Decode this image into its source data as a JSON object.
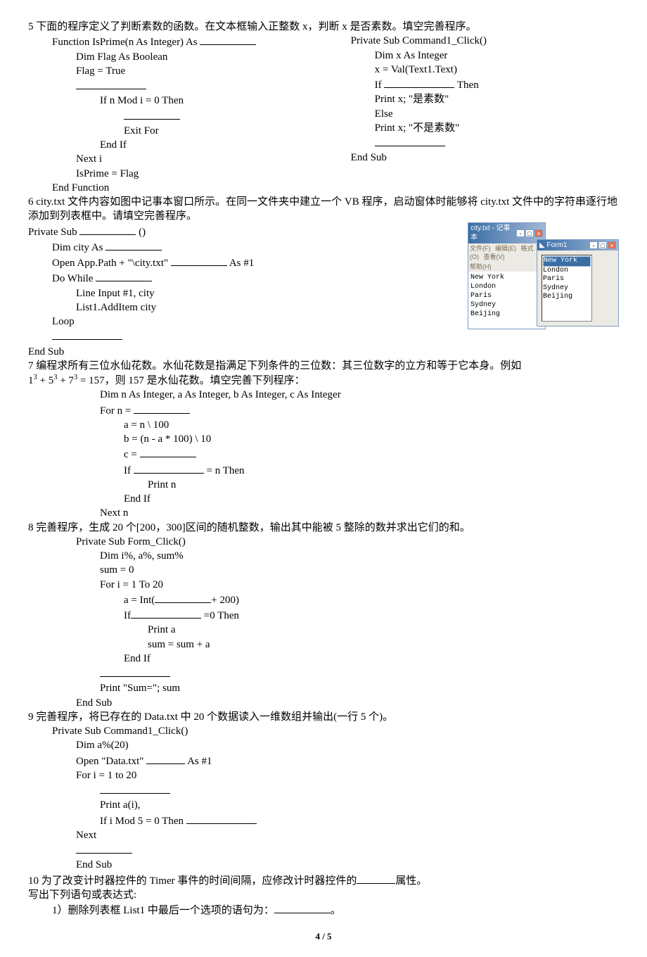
{
  "q5": {
    "prompt": "5 下面的程序定义了判断素数的函数。在文本框输入正整数 x，判断 x 是否素数。填空完善程序。",
    "left": {
      "l1a": "Function IsPrime(n As Integer) As ",
      "l2": "Dim Flag As Boolean",
      "l3": "Flag = True",
      "l5": "If n Mod i = 0 Then",
      "l7": "Exit For",
      "l8": "End If",
      "l9": "Next i",
      "l10": "IsPrime = Flag",
      "l11": "End Function"
    },
    "right": {
      "r1": "Private Sub Command1_Click()",
      "r2": "Dim x As Integer",
      "r3": "x = Val(Text1.Text)",
      "r4a": "If ",
      "r4b": " Then",
      "r5": "Print x; \"是素数\"",
      "r6": "Else",
      "r7": "Print x; \"不是素数\"",
      "r9": "End Sub"
    }
  },
  "q6": {
    "prompt": "6 city.txt 文件内容如图中记事本窗口所示。在同一文件夹中建立一个 VB 程序，启动窗体时能够将 city.txt 文件中的字符串逐行地添加到列表框中。请填空完善程序。",
    "l1a": "Private Sub ",
    "l1b": " ()",
    "l2a": "Dim city As ",
    "l3a": "Open App.Path + \"\\city.txt\" ",
    "l3b": " As #1",
    "l4a": "Do While ",
    "l5": "Line Input #1, city",
    "l6": "List1.AddItem city",
    "l7": "Loop",
    "l9": "End Sub",
    "notepad_title": "city.txt - 记事本",
    "menu": {
      "file": "文件(F)",
      "edit": "编辑(E)",
      "format": "格式(O)",
      "view": "查看(V)",
      "help": "帮助(H)"
    },
    "cities": [
      "New York",
      "London",
      "Paris",
      "Sydney",
      "Beijing"
    ],
    "form_title": "Form1"
  },
  "q7": {
    "prompt_a": "7 编程求所有三位水仙花数。水仙花数是指满足下列条件的三位数：其三位数字的立方和等于它本身。例如",
    "formula": "1³ + 5³ + 7³ = 157",
    "prompt_b": "，则 157 是水仙花数。填空完善下列程序：",
    "l1": "Dim n As Integer, a As Integer, b As Integer, c As Integer",
    "l2a": "For n = ",
    "l3": "a = n \\ 100",
    "l4": "b = (n - a * 100) \\ 10",
    "l5a": "c = ",
    "l6a": "If ",
    "l6b": " = n Then",
    "l7": "Print n",
    "l8": "End If",
    "l9": "Next n"
  },
  "q8": {
    "prompt": "8 完善程序，生成 20 个[200，300]区间的随机整数，输出其中能被 5 整除的数并求出它们的和。",
    "l1": "Private Sub Form_Click()",
    "l2": "Dim i%, a%, sum%",
    "l3": "sum = 0",
    "l4": "For i = 1 To 20",
    "l5a": "a = Int(",
    "l5b": "+ 200)",
    "l6a": "If",
    "l6b": " =0 Then",
    "l7": "Print a",
    "l8": "sum = sum + a",
    "l9": "End If",
    "l11": "Print \"Sum=\"; sum",
    "l12": "End Sub"
  },
  "q9": {
    "prompt": "9 完善程序，将已存在的 Data.txt 中 20 个数据读入一维数组并输出(一行 5 个)。",
    "l1": "Private Sub Command1_Click()",
    "l2": "Dim a%(20)",
    "l3a": "Open \"Data.txt\"  ",
    "l3b": "  As #1",
    "l4": "For i = 1 to 20",
    "l6": "Print a(i),",
    "l7a": "If i Mod 5 = 0 Then  ",
    "l8": "Next",
    "l10": "End Sub"
  },
  "q10": {
    "prompt_a": "10 为了改变计时器控件的 Timer 事件的时间间隔，应修改计时器控件的",
    "prompt_b": "属性。",
    "l2": "写出下列语句或表达式:",
    "l3a": "1）删除列表框 List1 中最后一个选项的语句为：",
    "l3b": "。"
  },
  "pagenum": "4 / 5"
}
